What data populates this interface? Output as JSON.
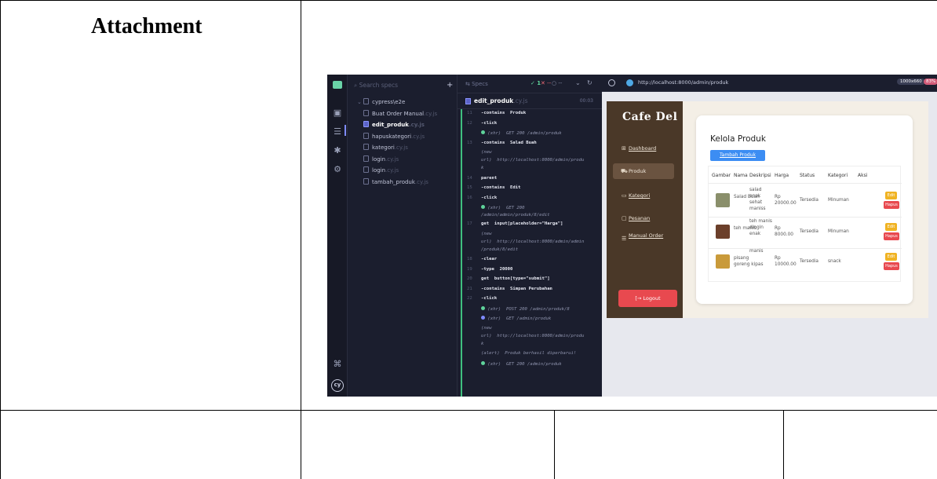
{
  "document": {
    "attachment_label": "Attachment"
  },
  "cypress": {
    "search_placeholder": "Search specs",
    "specs_label": "Specs",
    "passed": "✓ 1",
    "failed": "✕ --",
    "pending": "○ --",
    "tree": {
      "folder": "cypress\\e2e",
      "files": [
        {
          "name": "Buat Order Manual",
          "ext": ".cy.js",
          "active": false
        },
        {
          "name": "edit_produk",
          "ext": ".cy.js",
          "active": true
        },
        {
          "name": "hapuskategori",
          "ext": ".cy.js",
          "active": false
        },
        {
          "name": "kategori",
          "ext": ".cy.js",
          "active": false
        },
        {
          "name": "login",
          "ext": ".cy.js",
          "active": false
        },
        {
          "name": "login",
          "ext": ".cy.js",
          "active": false
        },
        {
          "name": "tambah_produk",
          "ext": ".cy.js",
          "active": false
        }
      ]
    },
    "spec_name": "edit_produk",
    "spec_ext": ".cy.js",
    "spec_time": "00:03",
    "commands": [
      {
        "n": "11",
        "text": "-contains  Produk"
      },
      {
        "n": "12",
        "text": "-click"
      },
      {
        "n": "",
        "text": "(xhr)  GET 200 /admin/produk"
      },
      {
        "n": "13",
        "text": "-contains  Salad Buah"
      },
      {
        "n": "",
        "text": "(new"
      },
      {
        "n": "",
        "text": "url)  http://localhost:8000/admin/produ"
      },
      {
        "n": "",
        "text": "k"
      },
      {
        "n": "14",
        "text": "parent"
      },
      {
        "n": "15",
        "text": "-contains  Edit"
      },
      {
        "n": "16",
        "text": "-click"
      },
      {
        "n": "",
        "text": "(xhr)  GET 200"
      },
      {
        "n": "",
        "text": "/admin/admin/produk/8/edit"
      },
      {
        "n": "17",
        "text": "get  input[placeholder=\"Harga\"]"
      },
      {
        "n": "",
        "text": "(new"
      },
      {
        "n": "",
        "text": "url)  http://localhost:8000/admin/admin"
      },
      {
        "n": "",
        "text": "/produk/8/edit"
      },
      {
        "n": "18",
        "text": "-clear"
      },
      {
        "n": "19",
        "text": "-type  20000"
      },
      {
        "n": "20",
        "text": "get  button[type=\"submit\"]"
      },
      {
        "n": "21",
        "text": "-contains  Simpan Perubahan"
      },
      {
        "n": "22",
        "text": "-click"
      },
      {
        "n": "",
        "text": "(xhr)  POST 200 /admin/produk/8"
      },
      {
        "n": "",
        "text": "(xhr)  GET /admin/produk"
      },
      {
        "n": "",
        "text": "(new"
      },
      {
        "n": "",
        "text": "url)  http://localhost:8000/admin/produ"
      },
      {
        "n": "",
        "text": "k"
      },
      {
        "n": "",
        "text": "(alert)  Produk berhasil diperbarui!"
      },
      {
        "n": "",
        "text": "(xhr)  GET 200 /admin/produk"
      }
    ],
    "url": "http://localhost:8000/admin/produk",
    "viewport": "1000x660",
    "zoom": "83%"
  },
  "app": {
    "brand": "Cafe Del",
    "nav": [
      {
        "label": "Dashboard",
        "icon": "grid-icon",
        "glyph": "⊞",
        "active": false
      },
      {
        "label": "Produk",
        "icon": "cart-icon",
        "glyph": "⛟",
        "active": true
      },
      {
        "label": "Kategori",
        "icon": "folder-icon",
        "glyph": "▭",
        "active": false
      },
      {
        "label": "Pesanan",
        "icon": "receipt-icon",
        "glyph": "▢",
        "active": false
      },
      {
        "label": "Manual Order",
        "icon": "list-icon",
        "glyph": "☰",
        "active": false
      }
    ],
    "logout": "[→ Logout",
    "card_title": "Kelola Produk",
    "add_button": "Tambah Produk",
    "columns": [
      "Gambar",
      "Nama",
      "Deskripsi",
      "Harga",
      "Status",
      "Kategori",
      "Aksi"
    ],
    "rows": [
      {
        "nama": "Salad Buah",
        "deskripsi": "salad enak sehat maniss",
        "harga": "Rp 20000.00",
        "status": "Tersedia",
        "kategori": "Minuman",
        "thumb_color": "#8a8f6b"
      },
      {
        "nama": "teh manis",
        "deskripsi": "teh manis dingin enak",
        "harga": "Rp 8000.00",
        "status": "Tersedia",
        "kategori": "Minuman",
        "thumb_color": "#6b3f2a"
      },
      {
        "nama": "pisang goreng kipas",
        "deskripsi": "manis",
        "harga": "Rp 10000.00",
        "status": "Tersedia",
        "kategori": "snack",
        "thumb_color": "#c99a3a"
      }
    ],
    "edit_label": "Edit",
    "delete_label": "Hapus"
  }
}
